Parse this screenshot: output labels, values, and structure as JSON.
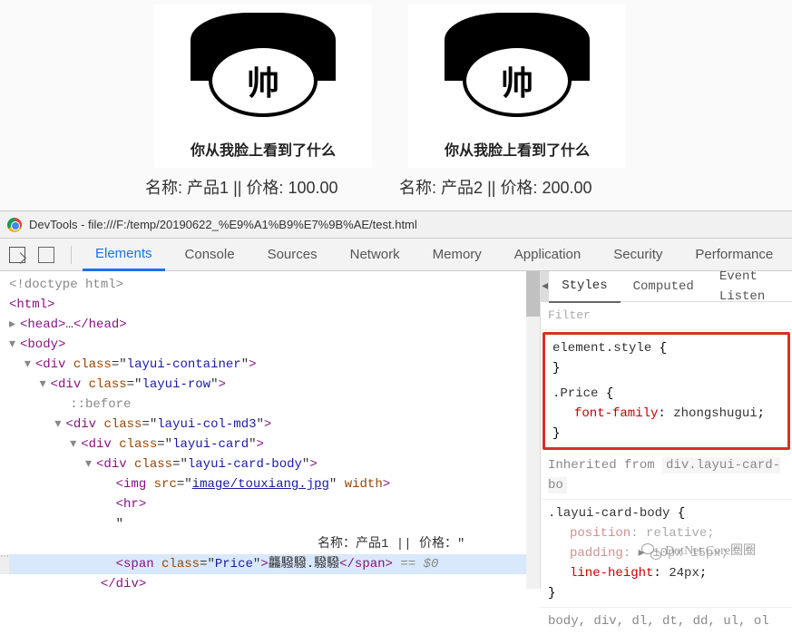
{
  "products": [
    {
      "face_text": "帅",
      "caption": "你从我脸上看到了什么",
      "name_label": "名称:",
      "name": "产品1",
      "sep": "||",
      "price_label": "价格:",
      "price": "100.00"
    },
    {
      "face_text": "帅",
      "caption": "你从我脸上看到了什么",
      "name_label": "名称:",
      "name": "产品2",
      "sep": "||",
      "price_label": "价格:",
      "price": "200.00"
    }
  ],
  "devtools": {
    "window_title": "DevTools - file:///F:/temp/20190622_%E9%A1%B9%E7%9B%AE/test.html",
    "tabs": {
      "elements": "Elements",
      "console": "Console",
      "sources": "Sources",
      "network": "Network",
      "memory": "Memory",
      "application": "Application",
      "security": "Security",
      "performance": "Performance"
    }
  },
  "elements": {
    "l1": "<!doctype html>",
    "l2_open": "<",
    "l2_tag": "html",
    "l2_close": ">",
    "l3_open": "<",
    "l3_tag": "head",
    "l3_close": ">",
    "l3_dots": "…",
    "l3_end_open": "</",
    "l3_end_close": ">",
    "l4_open": "<",
    "l4_tag": "body",
    "l4_close": ">",
    "l5_open": "<",
    "l5_tag": "div",
    "l5_attr": " class",
    "l5_eq": "=\"",
    "l5_val": "layui-container",
    "l5_q": "\"",
    "l5_close": ">",
    "l6_open": "<",
    "l6_tag": "div",
    "l6_attr": " class",
    "l6_eq": "=\"",
    "l6_val": "layui-row",
    "l6_q": "\"",
    "l6_close": ">",
    "l7": "::before",
    "l8_open": "<",
    "l8_tag": "div",
    "l8_attr": " class",
    "l8_eq": "=\"",
    "l8_val": "layui-col-md3",
    "l8_q": "\"",
    "l8_close": ">",
    "l9_open": "<",
    "l9_tag": "div",
    "l9_attr": " class",
    "l9_eq": "=\"",
    "l9_val": "layui-card",
    "l9_q": "\"",
    "l9_close": ">",
    "l10_open": "<",
    "l10_tag": "div",
    "l10_attr": " class",
    "l10_eq": "=\"",
    "l10_val": "layui-card-body",
    "l10_q": "\"",
    "l10_close": ">",
    "l11_open": "<",
    "l11_tag": "img",
    "l11_attr1": " src",
    "l11_eq1": "=\"",
    "l11_val1": "image/touxiang.jpg",
    "l11_q1": "\"",
    "l11_attr2": " width",
    "l11_close": ">",
    "l12_open": "<",
    "l12_tag": "hr",
    "l12_close": ">",
    "l13": "\"",
    "l14": "名称：产品1 || 价格：\"",
    "l15_open": "<",
    "l15_tag": "span",
    "l15_attr": " class",
    "l15_eq": "=\"",
    "l15_val": "Price",
    "l15_q": "\"",
    "l15_close": ">",
    "l15_text": "龘驋驋.驋驋",
    "l15_end_open": "</",
    "l15_end_close": ">",
    "l15_dollar": " == $0",
    "l16_open": "</",
    "l16_tag": "div",
    "l16_close": ">"
  },
  "styles": {
    "tabs": {
      "styles": "Styles",
      "computed": "Computed",
      "event": "Event Listen"
    },
    "filter_placeholder": "Filter",
    "rule1": {
      "selector": "element.style",
      "open": " {",
      "close": "}"
    },
    "rule2": {
      "selector": ".Price",
      "open": " {",
      "prop": "font-family",
      "colon": ": ",
      "value": "zhongshugui",
      "semi": ";",
      "close": "}"
    },
    "inherited_label": "Inherited from",
    "inherited_value": "div.layui-card-bo",
    "rule3": {
      "selector": ".layui-card-body",
      "open": " {",
      "p1": "position",
      "v1": "relative",
      "p2": "padding",
      "arrow": "▸",
      "v2": "10px 15px",
      "p3": "line-height",
      "v3": "24px",
      "semi": ";",
      "close": "}"
    },
    "last_line": "body, div, dl, dt, dd, ul, ol"
  },
  "watermark": "DotNet Core圈圈"
}
